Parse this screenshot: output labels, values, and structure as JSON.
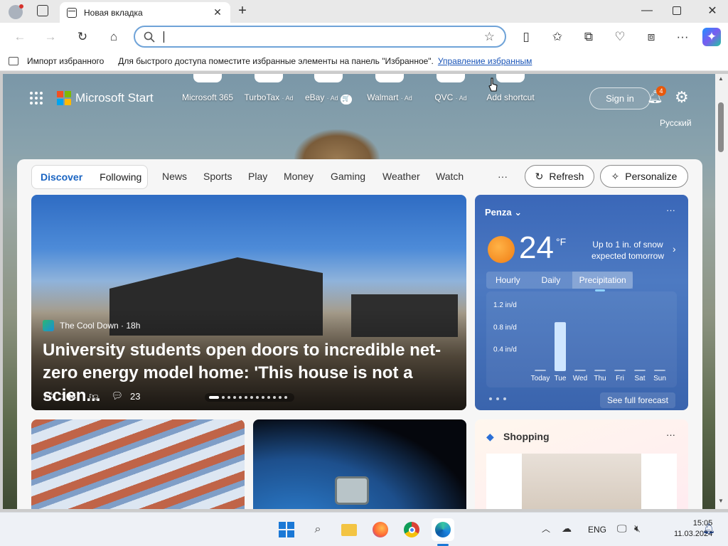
{
  "browser": {
    "tab_title": "Новая вкладка",
    "address_value": "",
    "favbar": {
      "import_label": "Импорт избранного",
      "hint": "Для быстрого доступа поместите избранные элементы на панель \"Избранное\".",
      "manage_link": "Управление избранным"
    }
  },
  "start": {
    "brand": "Microsoft Start",
    "shortcuts": [
      {
        "label": "Microsoft 365",
        "ad": ""
      },
      {
        "label": "TurboTax",
        "ad": "· Ad"
      },
      {
        "label": "eBay",
        "ad": "· Ad"
      },
      {
        "label": "Walmart",
        "ad": "· Ad"
      },
      {
        "label": "QVC",
        "ad": "· Ad"
      },
      {
        "label": "Add shortcut",
        "ad": ""
      }
    ],
    "sign_in": "Sign in",
    "notifications_count": "4",
    "language": "Русский",
    "nav": {
      "discover": "Discover",
      "following": "Following",
      "items": [
        "News",
        "Sports",
        "Play",
        "Money",
        "Gaming",
        "Weather",
        "Watch"
      ],
      "more": "···",
      "refresh": "Refresh",
      "personalize": "Personalize"
    },
    "hero": {
      "source": "The Cool Down · 18h",
      "title": "University students open doors to incredible net-zero energy model home: 'This house is not a scien...",
      "likes": "104",
      "comments": "23"
    },
    "weather": {
      "city": "Penza",
      "temp": "24",
      "unit": "°F",
      "message": "Up to 1 in. of snow expected tomorrow",
      "tabs": [
        "Hourly",
        "Daily",
        "Precipitation"
      ],
      "active_tab": "Precipitation",
      "forecast_link": "See full forecast",
      "chart_data": {
        "type": "bar",
        "categories": [
          "Today",
          "Tue",
          "Wed",
          "Thu",
          "Fri",
          "Sat",
          "Sun"
        ],
        "values": [
          0.02,
          0.88,
          0.01,
          0.01,
          0.01,
          0.01,
          0.01
        ],
        "yticks": [
          "1.2 in/d",
          "0.8 in/d",
          "0.4 in/d"
        ],
        "ylim": [
          0,
          1.2
        ]
      }
    },
    "shopping": {
      "title": "Shopping"
    }
  },
  "taskbar": {
    "lang": "ENG",
    "time": "15:05",
    "date": "11.03.2024"
  }
}
